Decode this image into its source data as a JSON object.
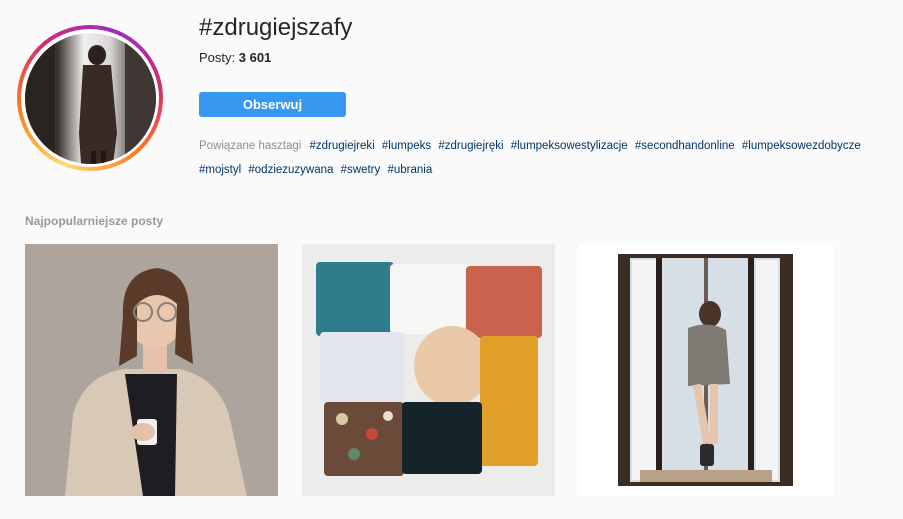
{
  "header": {
    "title": "#zdrugiejszafy",
    "posts_label": "Posty:",
    "posts_count": "3 601",
    "follow_label": "Obserwuj"
  },
  "related": {
    "label": "Powiązane hasztagi",
    "tags": [
      "#zdrugiejreki",
      "#lumpeks",
      "#zdrugiejręki",
      "#lumpeksowestylizacje",
      "#secondhandonline",
      "#lumpeksowezdobycze",
      "#mojstyl",
      "#odziezuzywana",
      "#swetry",
      "#ubrania"
    ]
  },
  "section": {
    "title": "Najpopularniejsze posty"
  },
  "colors": {
    "accent": "#3897f0",
    "tag": "#003569",
    "muted": "#8e8e8e"
  }
}
